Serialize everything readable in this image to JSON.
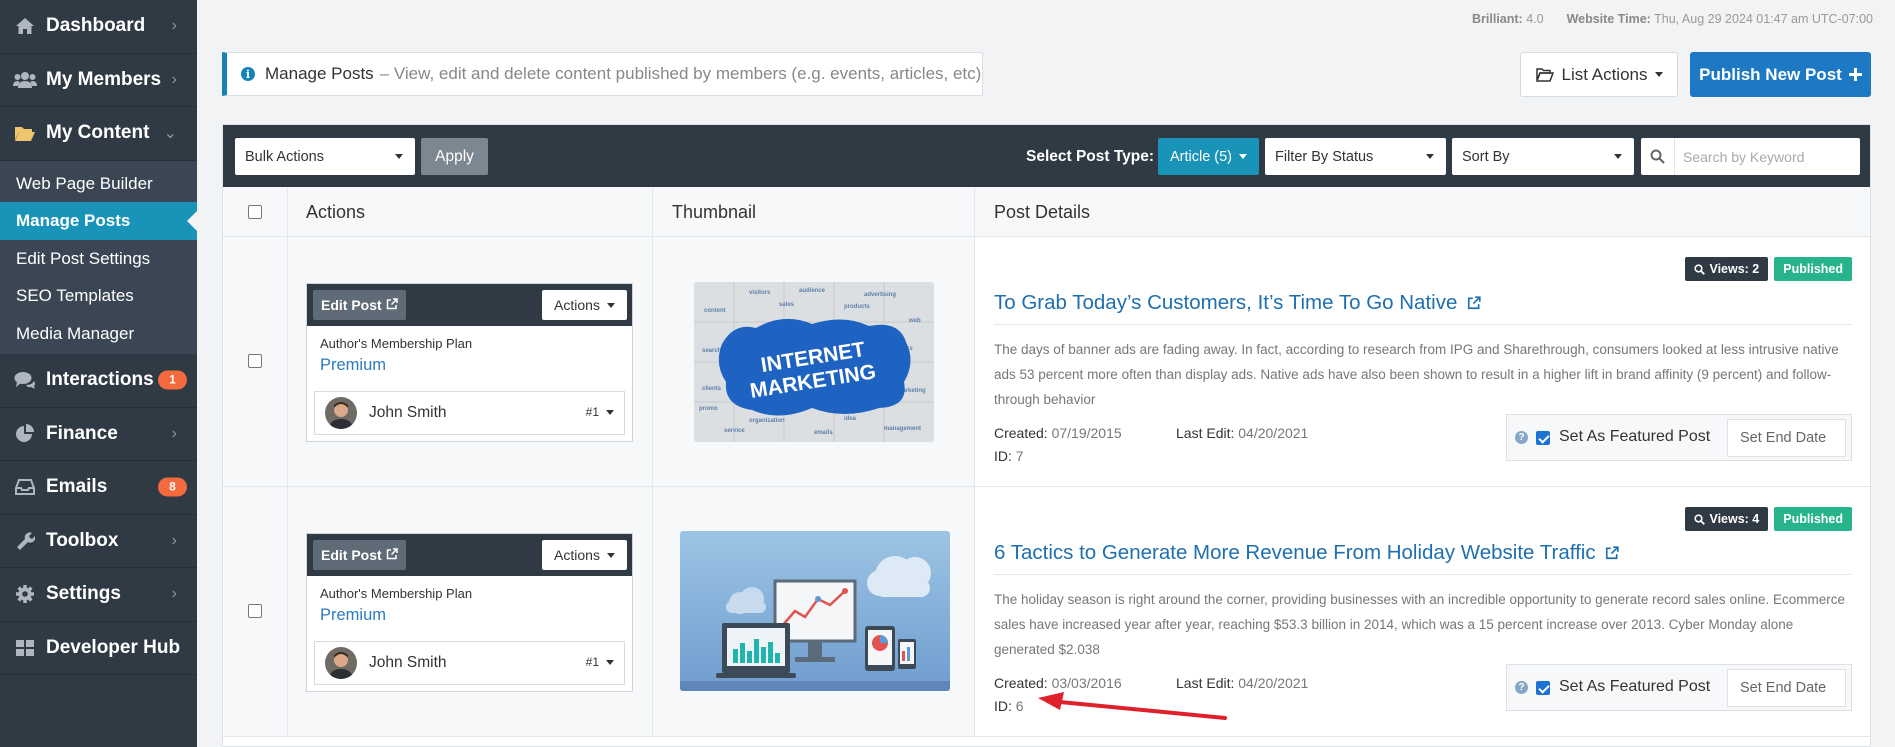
{
  "sidebar": {
    "items": [
      {
        "label": "Dashboard",
        "icon": "home-icon"
      },
      {
        "label": "My Members",
        "icon": "users-icon"
      },
      {
        "label": "My Content",
        "icon": "folder-open-icon"
      },
      {
        "label": "Interactions",
        "icon": "comments-icon",
        "count": "1"
      },
      {
        "label": "Finance",
        "icon": "pie-chart-icon"
      },
      {
        "label": "Emails",
        "icon": "inbox-icon",
        "count": "8"
      },
      {
        "label": "Toolbox",
        "icon": "wrench-icon"
      },
      {
        "label": "Settings",
        "icon": "gear-icon"
      },
      {
        "label": "Developer Hub",
        "icon": "grid-icon"
      }
    ],
    "sub_items": [
      "Web Page Builder",
      "Manage Posts",
      "Edit Post Settings",
      "SEO Templates",
      "Media Manager"
    ],
    "active_sub": "Manage Posts"
  },
  "topinfo": {
    "version_label": "Brilliant:",
    "version": "4.0",
    "time_label": "Website Time:",
    "time": "Thu, Aug 29 2024 01:47 am UTC-07:00"
  },
  "notice": {
    "title": "Manage Posts",
    "text": "– View, edit and delete content published by members (e.g. events, articles, etc)"
  },
  "header_buttons": {
    "list_actions": "List Actions",
    "publish": "Publish New Post"
  },
  "toolbar": {
    "bulk_actions": "Bulk Actions",
    "apply": "Apply",
    "post_type_label": "Select Post Type:",
    "post_type": "Article (5)",
    "filter_status": "Filter By Status",
    "sort_by": "Sort By",
    "search_placeholder": "Search by Keyword"
  },
  "columns": [
    "Actions",
    "Thumbnail",
    "Post Details"
  ],
  "posts": [
    {
      "edit_label": "Edit Post",
      "actions_label": "Actions",
      "plan_label": "Author's Membership Plan",
      "plan": "Premium",
      "author": "John Smith",
      "rank": "#1",
      "thumb_text_1": "INTERNET",
      "thumb_text_2": "MARKETING",
      "views": "Views: 2",
      "status": "Published",
      "title": "To Grab Today’s Customers, It’s Time To Go Native",
      "excerpt": "The days of banner ads are fading away. In fact, according to research from IPG and Sharethrough, consumers looked at less intrusive native ads 53 percent more often than display ads. Native ads have also been shown to result in a higher lift in brand affinity (9 percent) and follow-through behavior",
      "created_label": "Created:",
      "created": "07/19/2015",
      "last_edit_label": "Last Edit:",
      "last_edit": "04/20/2021",
      "id_label": "ID:",
      "id": "7",
      "featured_label": "Set As Featured Post",
      "end_date": "Set End Date"
    },
    {
      "edit_label": "Edit Post",
      "actions_label": "Actions",
      "plan_label": "Author's Membership Plan",
      "plan": "Premium",
      "author": "John Smith",
      "rank": "#1",
      "views": "Views: 4",
      "status": "Published",
      "title": "6 Tactics to Generate More Revenue From Holiday Website Traffic",
      "excerpt": "The holiday season is right around the corner, providing businesses with an incredible opportunity to generate record sales online. Ecommerce sales have increased year after year, reaching $53.3 billion in 2014, which was a 15 percent increase over 2013. Cyber Monday alone generated $2.038",
      "created_label": "Created:",
      "created": "03/03/2016",
      "last_edit_label": "Last Edit:",
      "last_edit": "04/20/2021",
      "id_label": "ID:",
      "id": "6",
      "featured_label": "Set As Featured Post",
      "end_date": "Set End Date"
    }
  ],
  "colors": {
    "sidebar_bg": "#2f3a45",
    "accent_teal": "#1a93b8",
    "primary_blue": "#1d79c4",
    "published_green": "#27b38c",
    "badge_orange": "#f26a3d",
    "annotation_red": "#e0202a"
  }
}
